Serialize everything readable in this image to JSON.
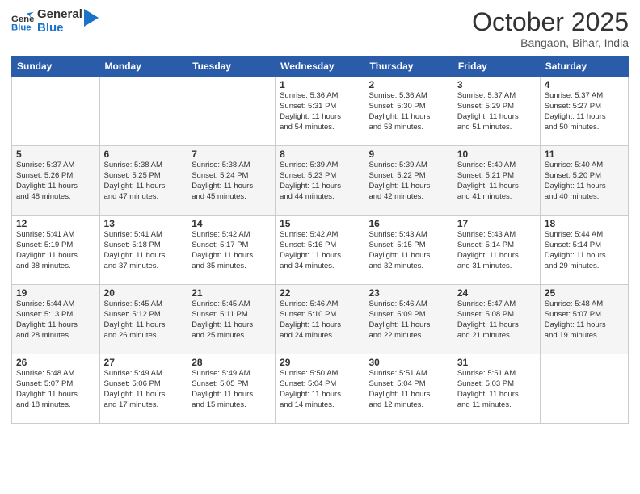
{
  "header": {
    "logo_line1": "General",
    "logo_line2": "Blue",
    "month": "October 2025",
    "location": "Bangaon, Bihar, India"
  },
  "weekdays": [
    "Sunday",
    "Monday",
    "Tuesday",
    "Wednesday",
    "Thursday",
    "Friday",
    "Saturday"
  ],
  "weeks": [
    [
      {
        "day": "",
        "info": ""
      },
      {
        "day": "",
        "info": ""
      },
      {
        "day": "",
        "info": ""
      },
      {
        "day": "1",
        "info": "Sunrise: 5:36 AM\nSunset: 5:31 PM\nDaylight: 11 hours\nand 54 minutes."
      },
      {
        "day": "2",
        "info": "Sunrise: 5:36 AM\nSunset: 5:30 PM\nDaylight: 11 hours\nand 53 minutes."
      },
      {
        "day": "3",
        "info": "Sunrise: 5:37 AM\nSunset: 5:29 PM\nDaylight: 11 hours\nand 51 minutes."
      },
      {
        "day": "4",
        "info": "Sunrise: 5:37 AM\nSunset: 5:27 PM\nDaylight: 11 hours\nand 50 minutes."
      }
    ],
    [
      {
        "day": "5",
        "info": "Sunrise: 5:37 AM\nSunset: 5:26 PM\nDaylight: 11 hours\nand 48 minutes."
      },
      {
        "day": "6",
        "info": "Sunrise: 5:38 AM\nSunset: 5:25 PM\nDaylight: 11 hours\nand 47 minutes."
      },
      {
        "day": "7",
        "info": "Sunrise: 5:38 AM\nSunset: 5:24 PM\nDaylight: 11 hours\nand 45 minutes."
      },
      {
        "day": "8",
        "info": "Sunrise: 5:39 AM\nSunset: 5:23 PM\nDaylight: 11 hours\nand 44 minutes."
      },
      {
        "day": "9",
        "info": "Sunrise: 5:39 AM\nSunset: 5:22 PM\nDaylight: 11 hours\nand 42 minutes."
      },
      {
        "day": "10",
        "info": "Sunrise: 5:40 AM\nSunset: 5:21 PM\nDaylight: 11 hours\nand 41 minutes."
      },
      {
        "day": "11",
        "info": "Sunrise: 5:40 AM\nSunset: 5:20 PM\nDaylight: 11 hours\nand 40 minutes."
      }
    ],
    [
      {
        "day": "12",
        "info": "Sunrise: 5:41 AM\nSunset: 5:19 PM\nDaylight: 11 hours\nand 38 minutes."
      },
      {
        "day": "13",
        "info": "Sunrise: 5:41 AM\nSunset: 5:18 PM\nDaylight: 11 hours\nand 37 minutes."
      },
      {
        "day": "14",
        "info": "Sunrise: 5:42 AM\nSunset: 5:17 PM\nDaylight: 11 hours\nand 35 minutes."
      },
      {
        "day": "15",
        "info": "Sunrise: 5:42 AM\nSunset: 5:16 PM\nDaylight: 11 hours\nand 34 minutes."
      },
      {
        "day": "16",
        "info": "Sunrise: 5:43 AM\nSunset: 5:15 PM\nDaylight: 11 hours\nand 32 minutes."
      },
      {
        "day": "17",
        "info": "Sunrise: 5:43 AM\nSunset: 5:14 PM\nDaylight: 11 hours\nand 31 minutes."
      },
      {
        "day": "18",
        "info": "Sunrise: 5:44 AM\nSunset: 5:14 PM\nDaylight: 11 hours\nand 29 minutes."
      }
    ],
    [
      {
        "day": "19",
        "info": "Sunrise: 5:44 AM\nSunset: 5:13 PM\nDaylight: 11 hours\nand 28 minutes."
      },
      {
        "day": "20",
        "info": "Sunrise: 5:45 AM\nSunset: 5:12 PM\nDaylight: 11 hours\nand 26 minutes."
      },
      {
        "day": "21",
        "info": "Sunrise: 5:45 AM\nSunset: 5:11 PM\nDaylight: 11 hours\nand 25 minutes."
      },
      {
        "day": "22",
        "info": "Sunrise: 5:46 AM\nSunset: 5:10 PM\nDaylight: 11 hours\nand 24 minutes."
      },
      {
        "day": "23",
        "info": "Sunrise: 5:46 AM\nSunset: 5:09 PM\nDaylight: 11 hours\nand 22 minutes."
      },
      {
        "day": "24",
        "info": "Sunrise: 5:47 AM\nSunset: 5:08 PM\nDaylight: 11 hours\nand 21 minutes."
      },
      {
        "day": "25",
        "info": "Sunrise: 5:48 AM\nSunset: 5:07 PM\nDaylight: 11 hours\nand 19 minutes."
      }
    ],
    [
      {
        "day": "26",
        "info": "Sunrise: 5:48 AM\nSunset: 5:07 PM\nDaylight: 11 hours\nand 18 minutes."
      },
      {
        "day": "27",
        "info": "Sunrise: 5:49 AM\nSunset: 5:06 PM\nDaylight: 11 hours\nand 17 minutes."
      },
      {
        "day": "28",
        "info": "Sunrise: 5:49 AM\nSunset: 5:05 PM\nDaylight: 11 hours\nand 15 minutes."
      },
      {
        "day": "29",
        "info": "Sunrise: 5:50 AM\nSunset: 5:04 PM\nDaylight: 11 hours\nand 14 minutes."
      },
      {
        "day": "30",
        "info": "Sunrise: 5:51 AM\nSunset: 5:04 PM\nDaylight: 11 hours\nand 12 minutes."
      },
      {
        "day": "31",
        "info": "Sunrise: 5:51 AM\nSunset: 5:03 PM\nDaylight: 11 hours\nand 11 minutes."
      },
      {
        "day": "",
        "info": ""
      }
    ]
  ]
}
